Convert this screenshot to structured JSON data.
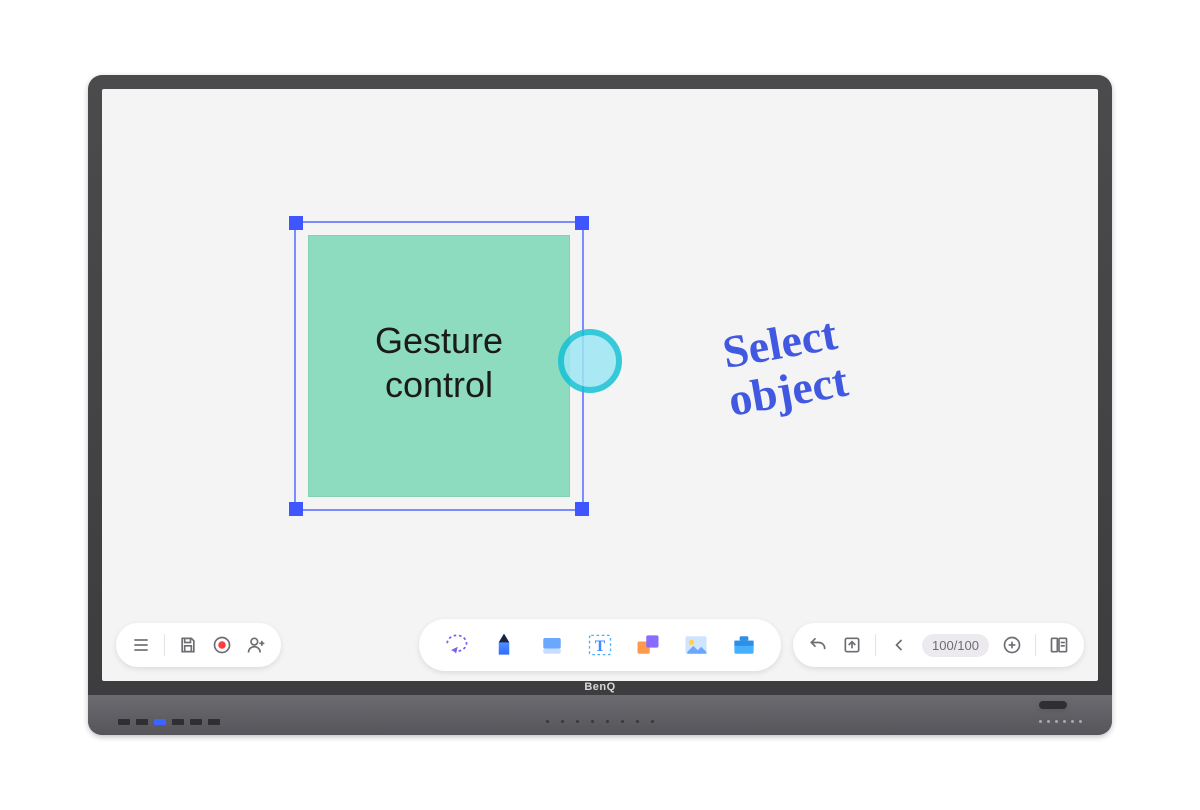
{
  "brand": "BenQ",
  "canvas": {
    "shape_label": "Gesture\ncontrol",
    "handwriting": "Select\nobject",
    "colors": {
      "selection_border": "#7c8cff",
      "selection_handle": "#3e55ff",
      "shape_fill": "#8edcc0",
      "touch_ring": "#16c2d6",
      "handwriting": "#4158e0"
    }
  },
  "toolbar_left": {
    "menu": "menu",
    "save": "save",
    "record": "record",
    "add_user": "add-user"
  },
  "toolbar_center": {
    "select": "select",
    "pen": "pen",
    "eraser": "eraser",
    "text": "text",
    "shapes": "shapes",
    "image": "image",
    "toolbox": "toolbox"
  },
  "toolbar_right": {
    "undo": "undo",
    "export": "export",
    "page_prev": "prev-page",
    "page_counter": "100/100",
    "page_add": "add-page",
    "pages": "page-overview"
  }
}
